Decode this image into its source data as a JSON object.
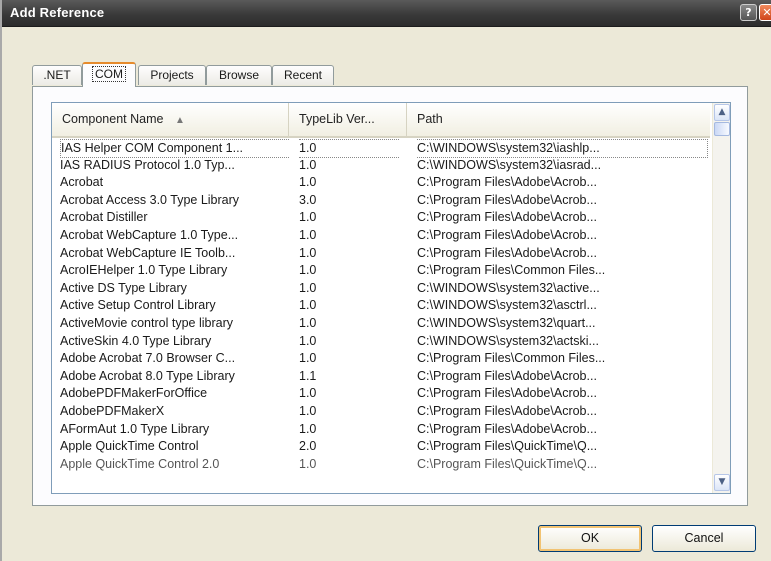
{
  "window": {
    "title": "Add Reference",
    "help_glyph": "?",
    "close_glyph": "✕"
  },
  "tabs": [
    {
      "label": ".NET",
      "selected": false
    },
    {
      "label": "COM",
      "selected": true
    },
    {
      "label": "Projects",
      "selected": false
    },
    {
      "label": "Browse",
      "selected": false
    },
    {
      "label": "Recent",
      "selected": false
    }
  ],
  "list": {
    "columns": [
      "Component Name",
      "TypeLib Ver...",
      "Path"
    ],
    "sort_indicator": "▲",
    "rows": [
      {
        "name": "IAS Helper COM Component 1...",
        "version": "1.0",
        "path": "C:\\WINDOWS\\system32\\iashlp..."
      },
      {
        "name": "IAS RADIUS Protocol 1.0 Typ...",
        "version": "1.0",
        "path": "C:\\WINDOWS\\system32\\iasrad..."
      },
      {
        "name": "Acrobat",
        "version": "1.0",
        "path": "C:\\Program Files\\Adobe\\Acrob..."
      },
      {
        "name": "Acrobat Access 3.0 Type Library",
        "version": "3.0",
        "path": "C:\\Program Files\\Adobe\\Acrob..."
      },
      {
        "name": "Acrobat Distiller",
        "version": "1.0",
        "path": "C:\\Program Files\\Adobe\\Acrob..."
      },
      {
        "name": "Acrobat WebCapture 1.0 Type...",
        "version": "1.0",
        "path": "C:\\Program Files\\Adobe\\Acrob..."
      },
      {
        "name": "Acrobat WebCapture IE Toolb...",
        "version": "1.0",
        "path": "C:\\Program Files\\Adobe\\Acrob..."
      },
      {
        "name": "AcroIEHelper 1.0 Type Library",
        "version": "1.0",
        "path": "C:\\Program Files\\Common Files..."
      },
      {
        "name": "Active DS Type Library",
        "version": "1.0",
        "path": "C:\\WINDOWS\\system32\\active..."
      },
      {
        "name": "Active Setup Control Library",
        "version": "1.0",
        "path": "C:\\WINDOWS\\system32\\asctrl..."
      },
      {
        "name": "ActiveMovie control type library",
        "version": "1.0",
        "path": "C:\\WINDOWS\\system32\\quart..."
      },
      {
        "name": "ActiveSkin 4.0 Type Library",
        "version": "1.0",
        "path": "C:\\WINDOWS\\system32\\actski..."
      },
      {
        "name": "Adobe Acrobat 7.0 Browser C...",
        "version": "1.0",
        "path": "C:\\Program Files\\Common Files..."
      },
      {
        "name": "Adobe Acrobat 8.0 Type Library",
        "version": "1.1",
        "path": "C:\\Program Files\\Adobe\\Acrob..."
      },
      {
        "name": "AdobePDFMakerForOffice",
        "version": "1.0",
        "path": "C:\\Program Files\\Adobe\\Acrob..."
      },
      {
        "name": "AdobePDFMakerX",
        "version": "1.0",
        "path": "C:\\Program Files\\Adobe\\Acrob..."
      },
      {
        "name": "AFormAut 1.0 Type Library",
        "version": "1.0",
        "path": "C:\\Program Files\\Adobe\\Acrob..."
      },
      {
        "name": "Apple QuickTime Control",
        "version": "2.0",
        "path": "C:\\Program Files\\QuickTime\\Q..."
      },
      {
        "name": "Apple QuickTime Control 2.0",
        "version": "1.0",
        "path": "C:\\Program Files\\QuickTime\\Q..."
      }
    ]
  },
  "scrollbar": {
    "up_glyph": "▲",
    "down_glyph": "▼"
  },
  "buttons": {
    "ok": "OK",
    "cancel": "Cancel"
  }
}
